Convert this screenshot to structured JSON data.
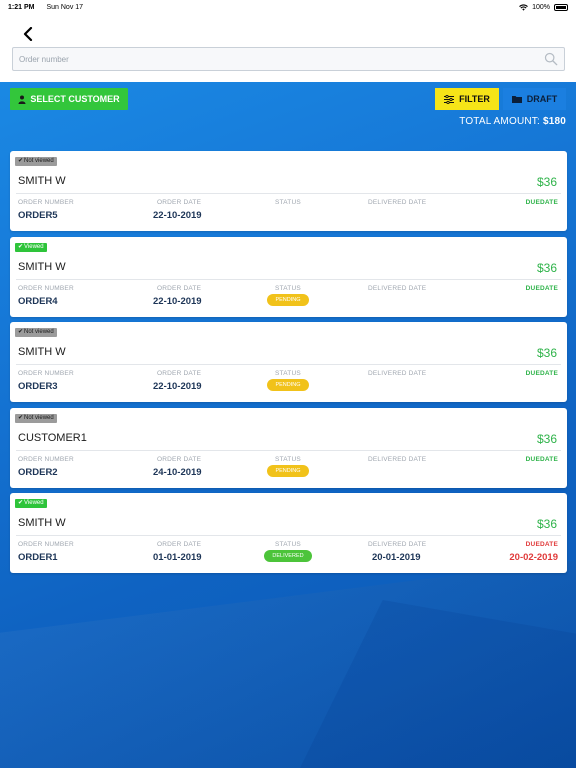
{
  "status_bar": {
    "time": "1:21 PM",
    "date": "Sun Nov 17",
    "battery": "100%"
  },
  "search": {
    "placeholder": "Order number",
    "value": ""
  },
  "actions": {
    "select_customer": "SELECT CUSTOMER",
    "filter": "FILTER",
    "draft": "DRAFT"
  },
  "total": {
    "label": "TOTAL AMOUNT:",
    "value": "$180"
  },
  "columns": {
    "order_number": "ORDER NUMBER",
    "order_date": "ORDER DATE",
    "status": "STATUS",
    "delivered_date": "DELIVERED DATE",
    "duedate": "DUEDATE"
  },
  "orders": [
    {
      "viewed_label": "Not viewed",
      "viewed": false,
      "customer": "SMITH W",
      "amount": "$36",
      "order_number": "ORDER5",
      "order_date": "22-10-2019",
      "status": "",
      "delivered_date": "",
      "due_date": ""
    },
    {
      "viewed_label": "Viewed",
      "viewed": true,
      "customer": "SMITH W",
      "amount": "$36",
      "order_number": "ORDER4",
      "order_date": "22-10-2019",
      "status": "PENDING",
      "delivered_date": "",
      "due_date": ""
    },
    {
      "viewed_label": "Not viewed",
      "viewed": false,
      "customer": "SMITH W",
      "amount": "$36",
      "order_number": "ORDER3",
      "order_date": "22-10-2019",
      "status": "PENDING",
      "delivered_date": "",
      "due_date": ""
    },
    {
      "viewed_label": "Not viewed",
      "viewed": false,
      "customer": "CUSTOMER1",
      "amount": "$36",
      "order_number": "ORDER2",
      "order_date": "24-10-2019",
      "status": "PENDING",
      "delivered_date": "",
      "due_date": ""
    },
    {
      "viewed_label": "Viewed",
      "viewed": true,
      "customer": "SMITH W",
      "amount": "$36",
      "order_number": "ORDER1",
      "order_date": "01-01-2019",
      "status": "DELIVERED",
      "delivered_date": "20-01-2019",
      "due_date": "20-02-2019"
    }
  ],
  "colors": {
    "accent_green": "#33c63b",
    "filter_yellow": "#f6e418",
    "pending": "#f1c21a",
    "delivered": "#4cc43a",
    "overdue_red": "#e03a3a",
    "background_blue": "#1677d6"
  }
}
